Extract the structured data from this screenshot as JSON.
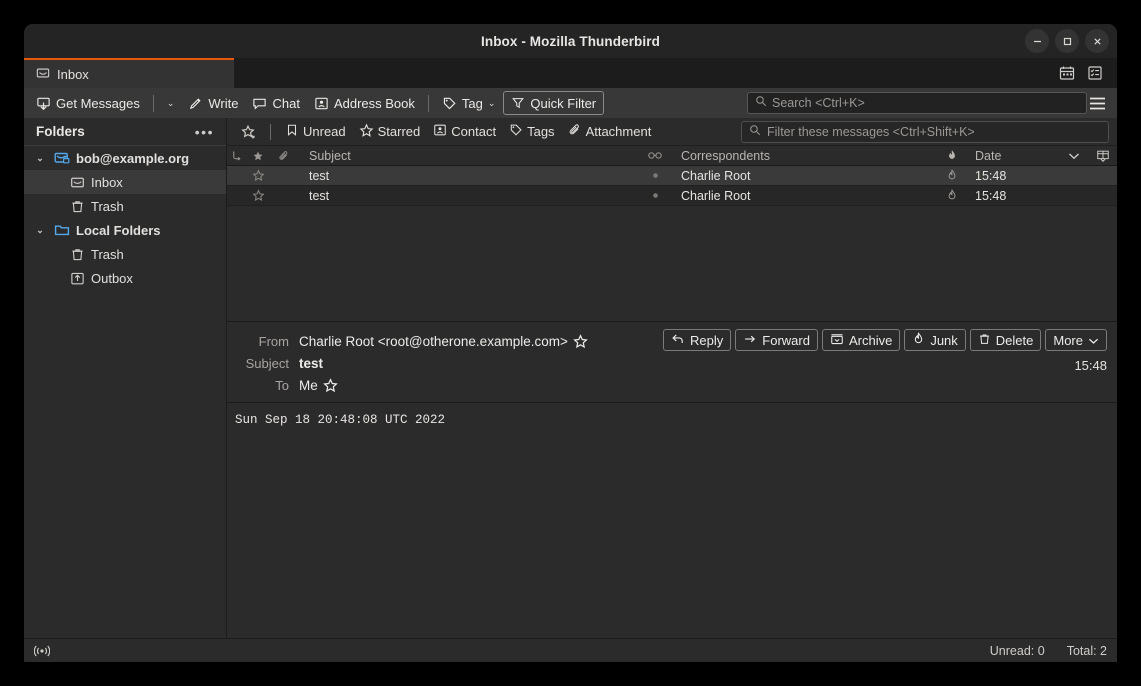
{
  "window": {
    "title": "Inbox - Mozilla Thunderbird",
    "controls": {
      "minimize": "minimize-icon",
      "maximize": "maximize-icon",
      "close": "close-icon"
    },
    "accent_color": "#e8590c"
  },
  "tabbar": {
    "tabs": [
      {
        "label": "Inbox",
        "icon": "inbox-mail-icon",
        "active": true
      }
    ],
    "right_icons": [
      "calendar-icon",
      "tasks-icon"
    ]
  },
  "toolbar": {
    "get_messages_label": "Get Messages",
    "get_messages_caret": "⌄",
    "write_label": "Write",
    "chat_label": "Chat",
    "address_book_label": "Address Book",
    "tag_label": "Tag",
    "tag_caret": "⌄",
    "quick_filter_label": "Quick Filter",
    "search_placeholder": "Search <Ctrl+K>",
    "menu_icon": "hamburger-menu-icon"
  },
  "sidebar": {
    "header": {
      "title": "Folders",
      "more": "•••"
    },
    "items": [
      {
        "label": "bob@example.org",
        "level": 0,
        "icon": "secure-mail-account-icon",
        "twisty": "⌄",
        "bold": true,
        "selected": false
      },
      {
        "label": "Inbox",
        "level": 1,
        "icon": "inbox-icon",
        "twisty": "",
        "bold": false,
        "selected": true
      },
      {
        "label": "Trash",
        "level": 1,
        "icon": "trash-icon",
        "twisty": "",
        "bold": false,
        "selected": false
      },
      {
        "label": "Local Folders",
        "level": 0,
        "icon": "folder-icon",
        "twisty": "⌄",
        "bold": true,
        "selected": false
      },
      {
        "label": "Trash",
        "level": 1,
        "icon": "trash-icon",
        "twisty": "",
        "bold": false,
        "selected": false
      },
      {
        "label": "Outbox",
        "level": 1,
        "icon": "outbox-icon",
        "twisty": "",
        "bold": false,
        "selected": false
      }
    ]
  },
  "quick_filter_bar": {
    "pin_icon": "pin-filter-icon",
    "buttons": [
      {
        "label": "Unread",
        "icon": "bookmark-icon"
      },
      {
        "label": "Starred",
        "icon": "star-icon"
      },
      {
        "label": "Contact",
        "icon": "contact-card-icon"
      },
      {
        "label": "Tags",
        "icon": "tag-icon"
      },
      {
        "label": "Attachment",
        "icon": "paperclip-icon"
      }
    ],
    "filter_placeholder": "Filter these messages <Ctrl+Shift+K>"
  },
  "message_list": {
    "columns": {
      "thread": "thread-column",
      "star": "star-column",
      "attachment": "attachment-column",
      "subject": "Subject",
      "read": "read-column",
      "correspondents": "Correspondents",
      "junk": "junk-column",
      "date": "Date",
      "sort_indicator": "⌄",
      "column_picker": "column-picker-icon"
    },
    "rows": [
      {
        "subject": "test",
        "correspondents": "Charlie Root",
        "date": "15:48",
        "selected": true,
        "starred": false,
        "read": true
      },
      {
        "subject": "test",
        "correspondents": "Charlie Root",
        "date": "15:48",
        "selected": false,
        "starred": false,
        "read": true
      }
    ]
  },
  "reader": {
    "from_label": "From",
    "from_value": "Charlie Root <root@otherone.example.com>",
    "subject_label": "Subject",
    "subject_value": "test",
    "to_label": "To",
    "to_value": "Me",
    "time": "15:48",
    "buttons": [
      {
        "label": "Reply",
        "icon": "reply-icon"
      },
      {
        "label": "Forward",
        "icon": "forward-icon"
      },
      {
        "label": "Archive",
        "icon": "archive-icon"
      },
      {
        "label": "Junk",
        "icon": "junk-flame-icon"
      },
      {
        "label": "Delete",
        "icon": "trash-icon"
      },
      {
        "label": "More",
        "icon": "chevron-down-icon"
      }
    ],
    "body": "Sun Sep 18 20:48:08 UTC 2022"
  },
  "statusbar": {
    "icon": "connection-activity-icon",
    "unread": "Unread: 0",
    "total": "Total: 2"
  }
}
